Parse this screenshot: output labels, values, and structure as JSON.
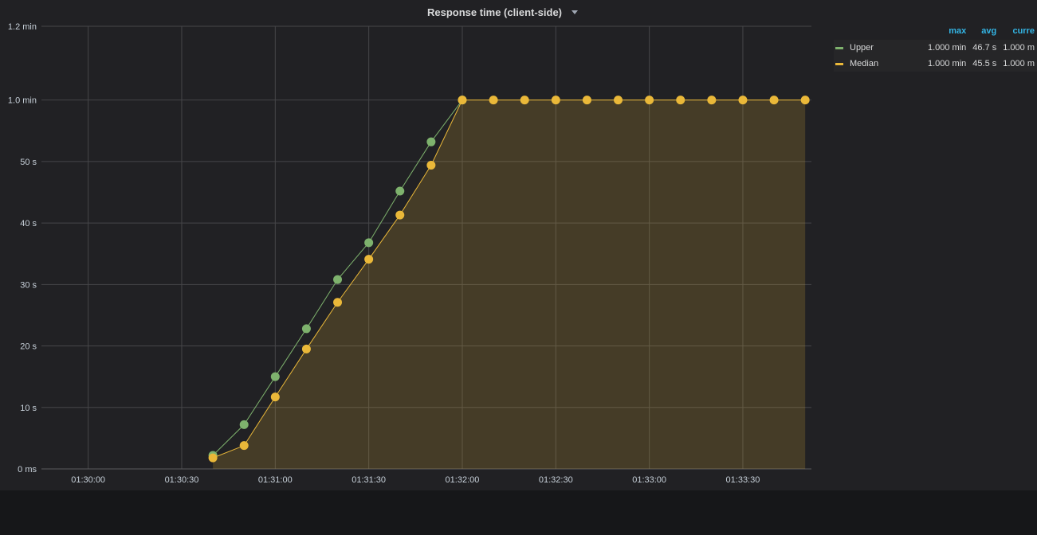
{
  "panel": {
    "title": "Response time (client-side)"
  },
  "legend": {
    "headers": [
      "max",
      "avg",
      "curre"
    ],
    "rows": [
      {
        "name": "Upper",
        "color": "#7eb26d",
        "max": "1.000 min",
        "avg": "46.7 s",
        "current": "1.000 m"
      },
      {
        "name": "Median",
        "color": "#eab839",
        "max": "1.000 min",
        "avg": "45.5 s",
        "current": "1.000 m"
      }
    ]
  },
  "chart_data": {
    "type": "line",
    "y_unit": "seconds",
    "ylim": [
      0,
      72
    ],
    "y_ticks": [
      {
        "value": 0,
        "label": "0 ms"
      },
      {
        "value": 10,
        "label": "10 s"
      },
      {
        "value": 20,
        "label": "20 s"
      },
      {
        "value": 30,
        "label": "30 s"
      },
      {
        "value": 40,
        "label": "40 s"
      },
      {
        "value": 50,
        "label": "50 s"
      },
      {
        "value": 60,
        "label": "1.0 min"
      },
      {
        "value": 72,
        "label": "1.2 min"
      }
    ],
    "xlim": [
      "01:29:45",
      "01:33:52"
    ],
    "x_ticks": [
      "01:30:00",
      "01:30:30",
      "01:31:00",
      "01:31:30",
      "01:32:00",
      "01:32:30",
      "01:33:00",
      "01:33:30"
    ],
    "grid": true,
    "legend_position": "right",
    "series": [
      {
        "name": "Upper",
        "color": "#7eb26d",
        "fill": false,
        "points": [
          [
            "01:30:40",
            2.2
          ],
          [
            "01:30:50",
            7.2
          ],
          [
            "01:31:00",
            15.0
          ],
          [
            "01:31:10",
            22.8
          ],
          [
            "01:31:20",
            30.8
          ],
          [
            "01:31:30",
            36.8
          ],
          [
            "01:31:40",
            45.2
          ],
          [
            "01:31:50",
            53.2
          ],
          [
            "01:32:00",
            60.0
          ]
        ]
      },
      {
        "name": "Median",
        "color": "#eab839",
        "fill": true,
        "points": [
          [
            "01:30:40",
            1.8
          ],
          [
            "01:30:50",
            3.8
          ],
          [
            "01:31:00",
            11.7
          ],
          [
            "01:31:10",
            19.5
          ],
          [
            "01:31:20",
            27.1
          ],
          [
            "01:31:30",
            34.1
          ],
          [
            "01:31:40",
            41.3
          ],
          [
            "01:31:50",
            49.4
          ],
          [
            "01:32:00",
            60.0
          ],
          [
            "01:32:10",
            60.0
          ],
          [
            "01:32:20",
            60.0
          ],
          [
            "01:32:30",
            60.0
          ],
          [
            "01:32:40",
            60.0
          ],
          [
            "01:32:50",
            60.0
          ],
          [
            "01:33:00",
            60.0
          ],
          [
            "01:33:10",
            60.0
          ],
          [
            "01:33:20",
            60.0
          ],
          [
            "01:33:30",
            60.0
          ],
          [
            "01:33:40",
            60.0
          ],
          [
            "01:33:50",
            60.0
          ]
        ]
      }
    ]
  }
}
